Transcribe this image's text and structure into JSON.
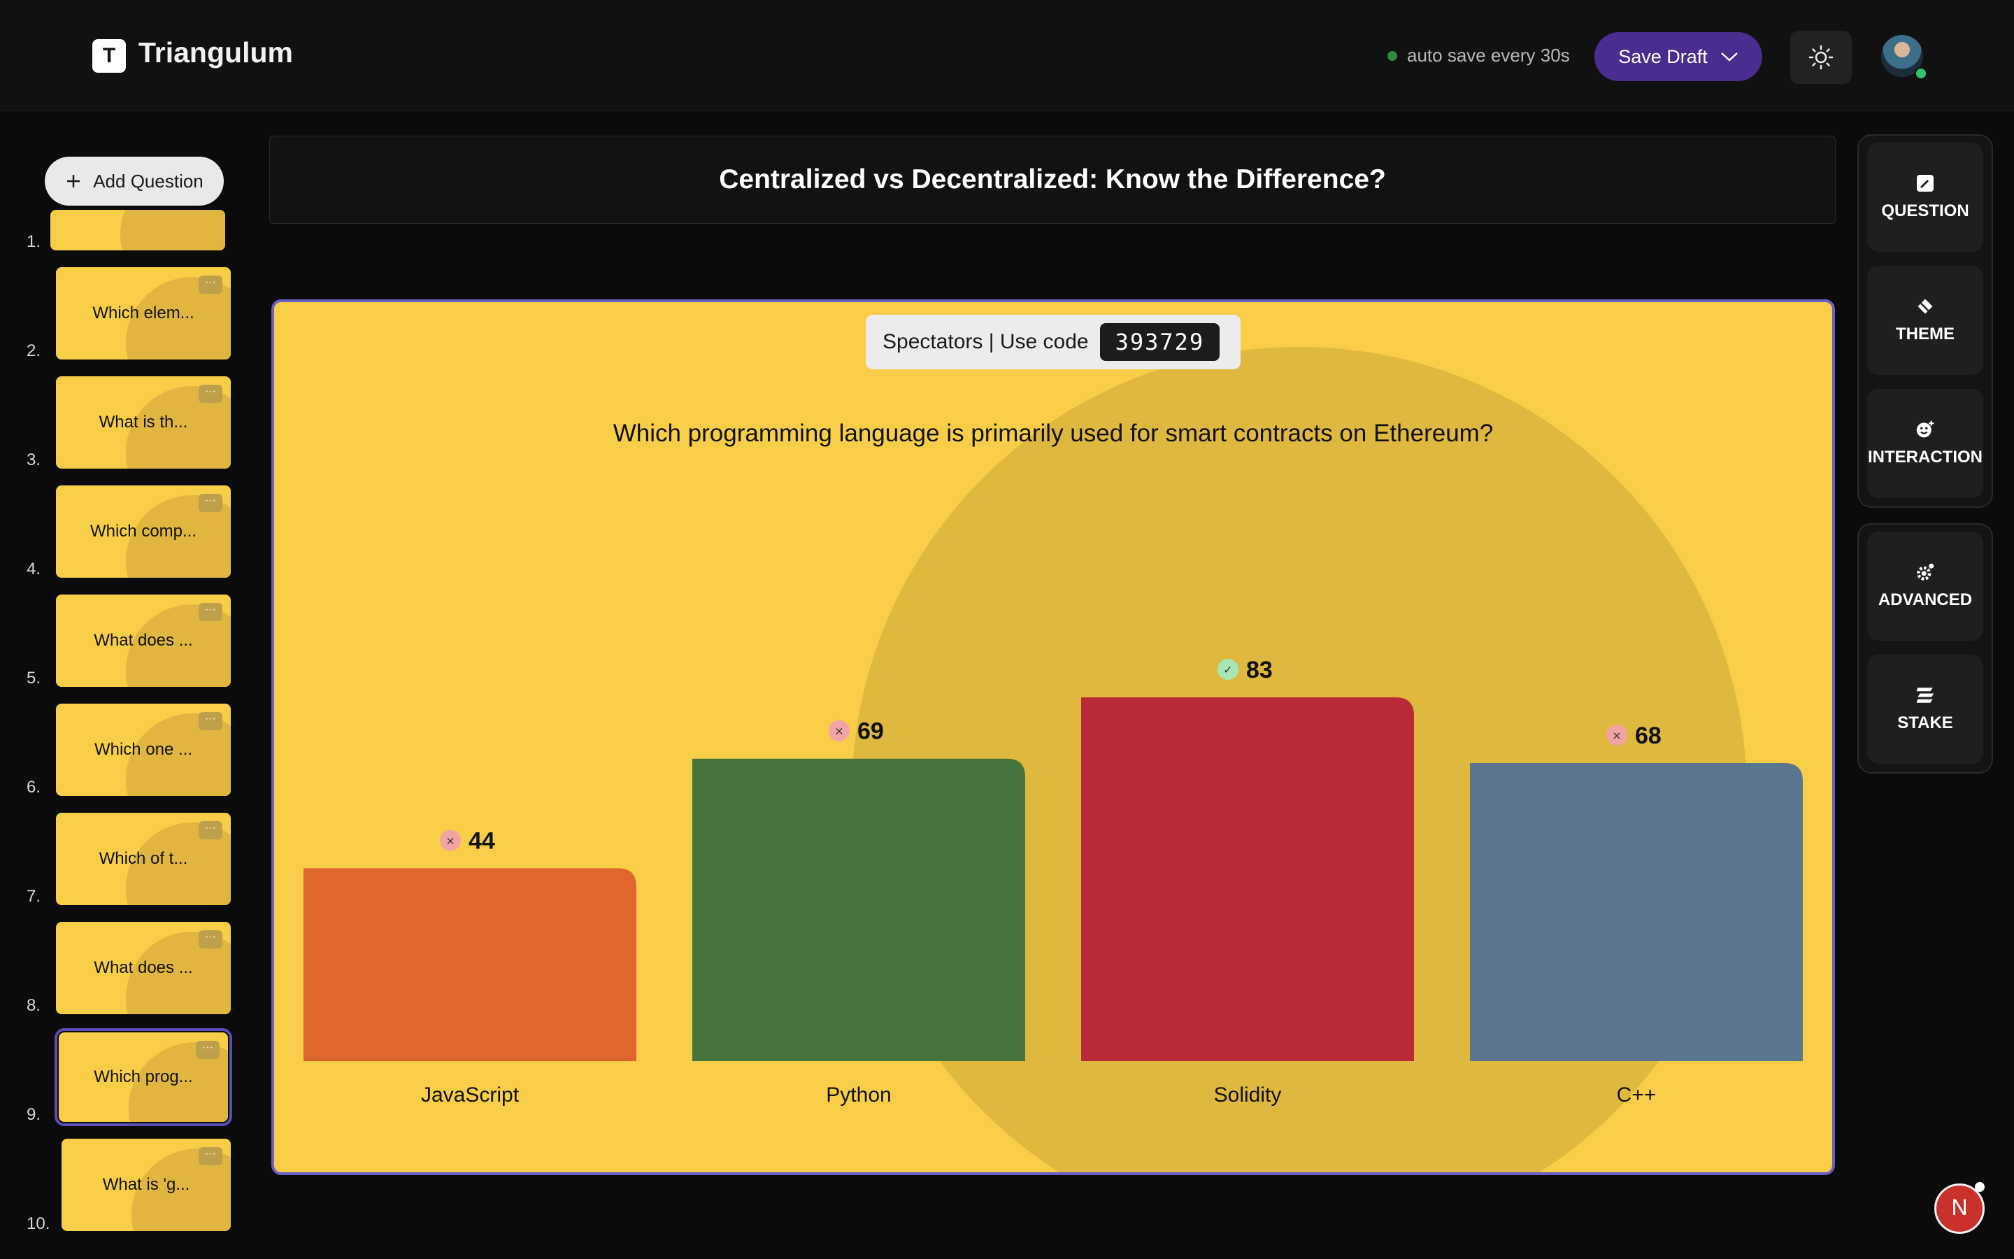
{
  "app": {
    "logo_letter": "T",
    "title": "Triangulum"
  },
  "header": {
    "autosave_text": "auto save every 30s",
    "save_draft_label": "Save Draft",
    "avatar_initial": "N"
  },
  "sidebar": {
    "add_question_label": "Add Question",
    "questions": [
      {
        "num": "1.",
        "label": ""
      },
      {
        "num": "2.",
        "label": "Which elem..."
      },
      {
        "num": "3.",
        "label": "What is th..."
      },
      {
        "num": "4.",
        "label": "Which comp..."
      },
      {
        "num": "5.",
        "label": "What does ..."
      },
      {
        "num": "6.",
        "label": "Which one ..."
      },
      {
        "num": "7.",
        "label": "Which of t..."
      },
      {
        "num": "8.",
        "label": "What does ..."
      },
      {
        "num": "9.",
        "label": "Which prog..."
      },
      {
        "num": "10.",
        "label": "What is 'g..."
      }
    ],
    "active_index": 8,
    "thumb_menu": "···"
  },
  "quiz_title": "Centralized vs Decentralized: Know the Difference?",
  "slide": {
    "spectators_label": "Spectators | Use code",
    "code": "393729",
    "question": "Which programming language is primarily used for smart contracts on Ethereum?"
  },
  "right_panel": {
    "group1": [
      "QUESTION",
      "THEME",
      "INTERACTION"
    ],
    "group2": [
      "ADVANCED",
      "STAKE"
    ]
  },
  "colors": {
    "accent_purple": "#4b2c8f",
    "slide_bg": "#f8ce48",
    "correct": "#a8e6b8",
    "wrong": "#f2a3a3"
  },
  "chart_data": {
    "type": "bar",
    "categories": [
      "JavaScript",
      "Python",
      "Solidity",
      "C++"
    ],
    "values": [
      44,
      69,
      83,
      68
    ],
    "correct": [
      false,
      false,
      true,
      false
    ],
    "colors": [
      "#de652b",
      "#47743d",
      "#b82b36",
      "#5b758e"
    ],
    "ylim": [
      0,
      83
    ]
  }
}
